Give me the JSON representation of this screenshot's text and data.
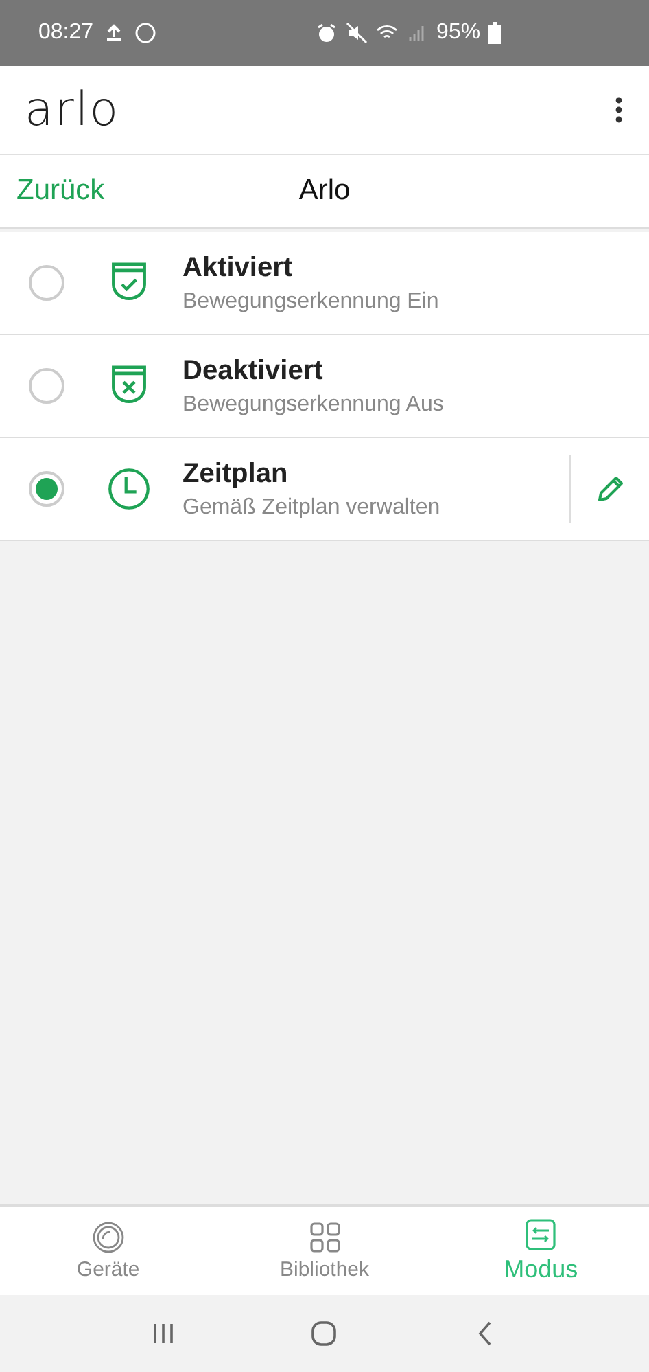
{
  "status_bar": {
    "time": "08:27",
    "battery": "95%"
  },
  "app_bar": {
    "logo": "arlo"
  },
  "nav": {
    "back": "Zurück",
    "title": "Arlo"
  },
  "modes": [
    {
      "kind": "active",
      "title": "Aktiviert",
      "subtitle": "Bewegungserkennung Ein",
      "selected": false,
      "editable": false
    },
    {
      "kind": "inactive",
      "title": "Deaktiviert",
      "subtitle": "Bewegungserkennung Aus",
      "selected": false,
      "editable": false
    },
    {
      "kind": "schedule",
      "title": "Zeitplan",
      "subtitle": "Gemäß Zeitplan verwalten",
      "selected": true,
      "editable": true
    }
  ],
  "tabs": [
    {
      "kind": "devices",
      "label": "Geräte",
      "selected": false
    },
    {
      "kind": "library",
      "label": "Bibliothek",
      "selected": false
    },
    {
      "kind": "mode",
      "label": "Modus",
      "selected": true
    }
  ]
}
